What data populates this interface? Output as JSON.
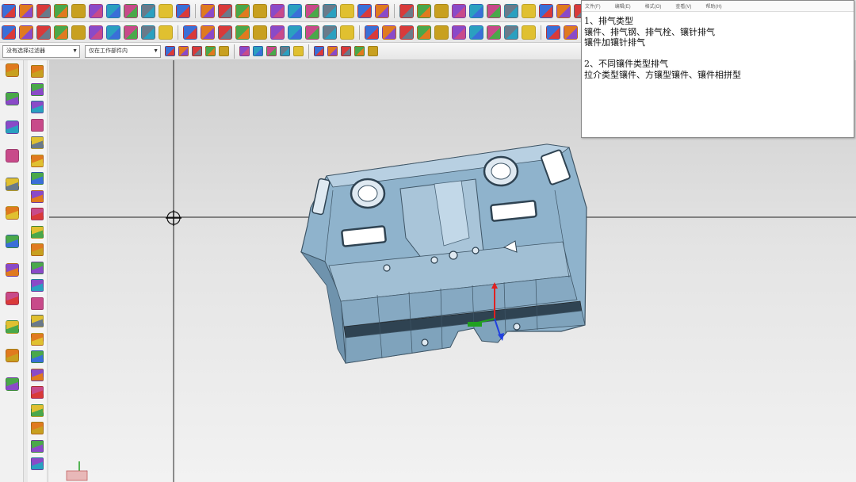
{
  "toolbar3": {
    "filter_combo": "没有选择过滤器",
    "assembly_combo": "仅在工作部件内"
  },
  "notes": {
    "menu": [
      "文件(F)",
      "编辑(E)",
      "格式(O)",
      "查看(V)",
      "帮助(H)"
    ],
    "lines": [
      "1、排气类型",
      "镶件、排气钢、排气栓、镶针排气",
      "镶件加镶针排气",
      "",
      "2、不同镶件类型排气",
      "拉介类型镶件、方镶型镶件、镶件相拼型"
    ]
  },
  "icons": {
    "toolbar_row1": [
      "new-file-icon",
      "open-icon",
      "save-icon",
      "undo-icon",
      "block-icon",
      "cylinder-icon",
      "cone-icon",
      "sphere-icon",
      "extrude-icon",
      "revolve-icon",
      "hole-icon",
      "boss-icon",
      "pocket-icon",
      "pad-icon",
      "slot-icon",
      "groove-icon",
      "emboss-icon",
      "offset-icon",
      "thicken-icon",
      "shell-icon",
      "blend-icon",
      "chamfer-icon",
      "trim-body-icon",
      "split-body-icon",
      "unite-icon",
      "subtract-icon",
      "intersect-icon",
      "pattern-icon",
      "mirror-icon",
      "sew-icon",
      "patch-icon",
      "move-face-icon",
      "delete-face-icon",
      "replace-face-icon",
      "resize-face-icon",
      "offset-region-icon",
      "draft-icon",
      "measure-icon"
    ],
    "toolbar_row2": [
      "select-all-icon",
      "snap-icon",
      "wcs-icon",
      "layer-icon",
      "show-hide-icon",
      "fit-icon",
      "zoom-icon",
      "rotate-icon",
      "pan-icon",
      "shaded-icon",
      "wireframe-icon",
      "section-icon",
      "trimetric-icon",
      "isometric-icon",
      "front-view-icon",
      "top-view-icon",
      "right-view-icon",
      "left-view-icon",
      "bottom-view-icon",
      "back-view-icon",
      "mold-wizard-icon",
      "parting-icon",
      "core-icon",
      "cavity-icon",
      "slider-icon",
      "lifter-icon",
      "insert-icon",
      "ejector-icon",
      "cooling-icon",
      "gate-icon",
      "runner-icon",
      "electrode-icon",
      "bom-icon",
      "drawing-icon"
    ],
    "toolbar_row3": [
      "filter-icon",
      "point-snap-icon",
      "endpoint-icon",
      "midpoint-icon",
      "center-icon",
      "quadrant-icon",
      "intersection-icon",
      "on-curve-icon",
      "on-face-icon",
      "existing-point-icon",
      "arc-center-icon",
      "tangent-icon",
      "select-face-icon",
      "select-body-icon",
      "select-edge-icon"
    ],
    "resource_bar": [
      "assembly-navigator-icon",
      "constraint-navigator-icon",
      "part-navigator-icon",
      "reuse-library-icon",
      "history-icon",
      "internet-icon",
      "roles-icon",
      "system-materials-icon",
      "palette-icon",
      "process-navigator-icon",
      "web-browser-icon",
      "print-icon"
    ],
    "vertical_toolbar": [
      "document-icon",
      "folder-icon",
      "grid-icon",
      "curve-icon",
      "surface-icon",
      "mesh-icon",
      "frame-icon",
      "knife-icon",
      "sphere-icon",
      "cube-icon",
      "tube-icon",
      "cabinet-icon",
      "support-icon",
      "flag-icon",
      "arrow-icon",
      "wrench-icon",
      "box-icon",
      "list-icon",
      "chart-icon",
      "tree-icon",
      "table-icon",
      "panel-icon",
      "umbrella-icon"
    ],
    "viewport": [
      "crosshair-icon",
      "csys-icon",
      "wcs-triad-icon"
    ]
  },
  "colors": {
    "model": "#8fb3cc",
    "model_dark": "#3e5566",
    "axis_z": "#e02020",
    "axis_y": "#20a020",
    "axis_x": "#2040e0"
  }
}
